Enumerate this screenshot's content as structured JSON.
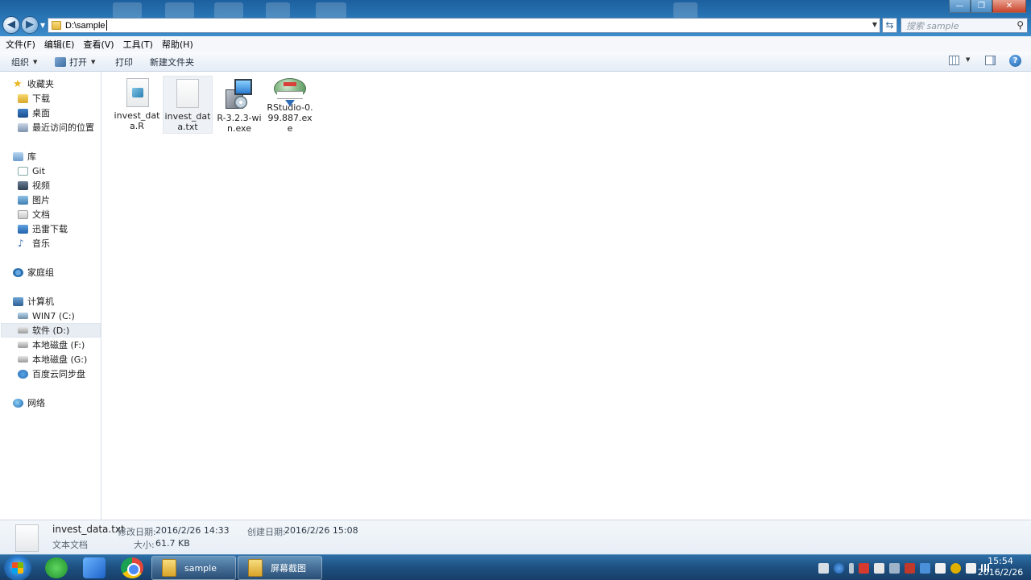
{
  "window": {
    "controls": {
      "minimize": "—",
      "maximize": "❐",
      "close": "✕"
    }
  },
  "address": {
    "path": "D:\\sample",
    "search_placeholder": "搜索 sample"
  },
  "menu": [
    "文件(F)",
    "编辑(E)",
    "查看(V)",
    "工具(T)",
    "帮助(H)"
  ],
  "commands": {
    "organize": "组织",
    "open": "打开",
    "print": "打印",
    "new_folder": "新建文件夹"
  },
  "nav": {
    "favorites": "收藏夹",
    "favorites_items": [
      "下载",
      "桌面",
      "最近访问的位置"
    ],
    "libraries": "库",
    "library_items": [
      "Git",
      "视频",
      "图片",
      "文档",
      "迅雷下载",
      "音乐"
    ],
    "homegroup": "家庭组",
    "computer": "计算机",
    "computer_items": [
      "WIN7 (C:)",
      "软件 (D:)",
      "本地磁盘 (F:)",
      "本地磁盘 (G:)",
      "百度云同步盘"
    ],
    "network": "网络",
    "selected": "软件 (D:)"
  },
  "files": [
    {
      "name": "invest_data.R",
      "icon": "r-script-icon"
    },
    {
      "name": "invest_data.txt",
      "icon": "text-file-icon",
      "selected": true
    },
    {
      "name": "R-3.2.3-win.exe",
      "icon": "installer-icon"
    },
    {
      "name": "RStudio-0.99.887.exe",
      "icon": "rstudio-installer-icon"
    }
  ],
  "details": {
    "file_name": "invest_data.txt",
    "file_type": "文本文档",
    "modified_label": "修改日期:",
    "modified_value": "2016/2/26 14:33",
    "created_label": "创建日期:",
    "created_value": "2016/2/26 15:08",
    "size_label": "大小:",
    "size_value": "61.7 KB"
  },
  "taskbar": {
    "tasks": [
      "sample",
      "屏幕截图"
    ],
    "time": "15:54",
    "date": "2016/2/26"
  }
}
